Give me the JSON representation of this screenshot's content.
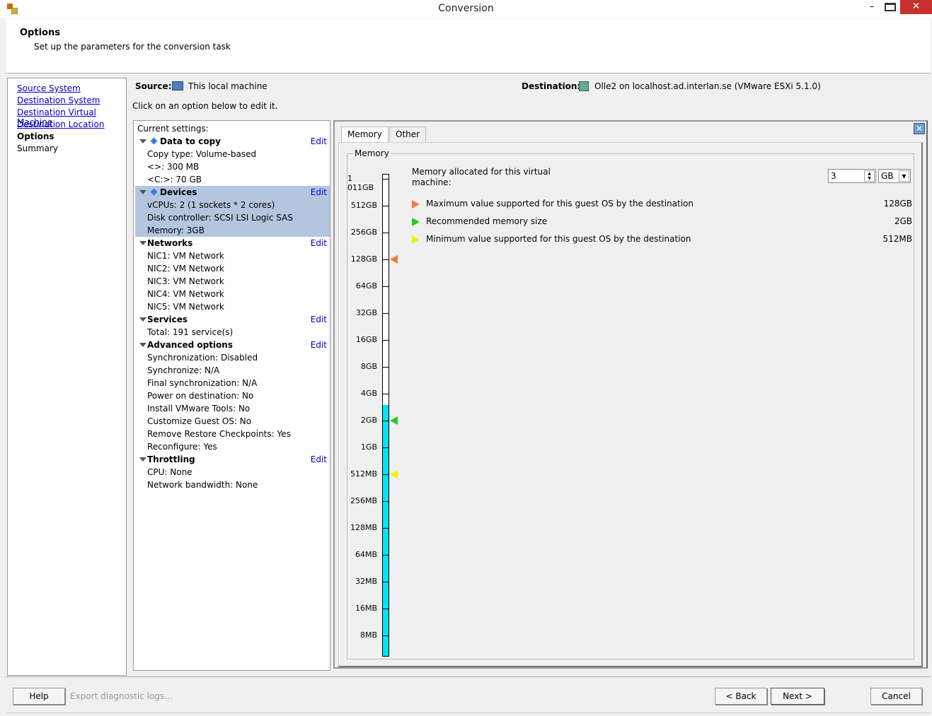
{
  "window": {
    "title": "Conversion"
  },
  "header": {
    "title": "Options",
    "subtitle": "Set up the parameters for the conversion task"
  },
  "nav": [
    {
      "label": "Source System",
      "link": true
    },
    {
      "label": "Destination System",
      "link": true
    },
    {
      "label": "Destination Virtual Machine",
      "link": true
    },
    {
      "label": "Destination Location",
      "link": true
    },
    {
      "label": "Options",
      "current": true
    },
    {
      "label": "Summary"
    }
  ],
  "source": {
    "label": "Source:",
    "value": "This local machine"
  },
  "destination": {
    "label": "Destination:",
    "value": "Olle2 on localhost.ad.interlan.se (VMware ESXi 5.1.0)"
  },
  "hint": "Click on an option below to edit it.",
  "settings": {
    "title": "Current settings:",
    "edit_label": "Edit",
    "sections": [
      {
        "name": "Data to copy",
        "diamond": true,
        "items": [
          "Copy type: Volume-based",
          "<>: 300 MB",
          "<C:>: 70 GB"
        ]
      },
      {
        "name": "Devices",
        "diamond": true,
        "selected": true,
        "items": [
          "vCPUs: 2 (1 sockets * 2 cores)",
          "Disk controller: SCSI LSI Logic SAS",
          "Memory: 3GB"
        ]
      },
      {
        "name": "Networks",
        "items": [
          "NIC1: VM Network",
          "NIC2: VM Network",
          "NIC3: VM Network",
          "NIC4: VM Network",
          "NIC5: VM Network"
        ]
      },
      {
        "name": "Services",
        "items": [
          "Total: 191 service(s)"
        ]
      },
      {
        "name": "Advanced options",
        "items": [
          "Synchronization: Disabled",
          "Synchronize: N/A",
          "Final synchronization: N/A",
          "Power on destination: No",
          "Install VMware Tools: No",
          "Customize Guest OS: No",
          "Remove Restore Checkpoints: Yes",
          "Reconfigure: Yes"
        ]
      },
      {
        "name": "Throttling",
        "items": [
          "CPU: None",
          "Network bandwidth: None"
        ]
      }
    ]
  },
  "tabs": [
    {
      "label": "Memory",
      "active": true
    },
    {
      "label": "Other"
    }
  ],
  "memory": {
    "group_label": "Memory",
    "allocated_label": "Memory allocated for this virtual machine:",
    "value": "3",
    "unit": "GB",
    "allocated_gb": 3,
    "scale_labels": [
      "1 011GB",
      "512GB",
      "256GB",
      "128GB",
      "64GB",
      "32GB",
      "16GB",
      "8GB",
      "4GB",
      "2GB",
      "1GB",
      "512MB",
      "256MB",
      "128MB",
      "64MB",
      "32MB",
      "16MB",
      "8MB"
    ],
    "fill_color": "#00e5f0",
    "legend": [
      {
        "text": "Maximum value supported for this guest OS by the destination",
        "value": "128GB",
        "gb": 128,
        "color": "#f07a3c"
      },
      {
        "text": "Recommended memory size",
        "value": "2GB",
        "gb": 2,
        "color": "#22cc22"
      },
      {
        "text": "Minimum value supported for this guest OS by the destination",
        "value": "512MB",
        "gb": 0.5,
        "color": "#f2f200"
      }
    ]
  },
  "footer": {
    "help": "Help",
    "export": "Export diagnostic logs...",
    "back": "< Back",
    "next": "Next >",
    "cancel": "Cancel"
  }
}
